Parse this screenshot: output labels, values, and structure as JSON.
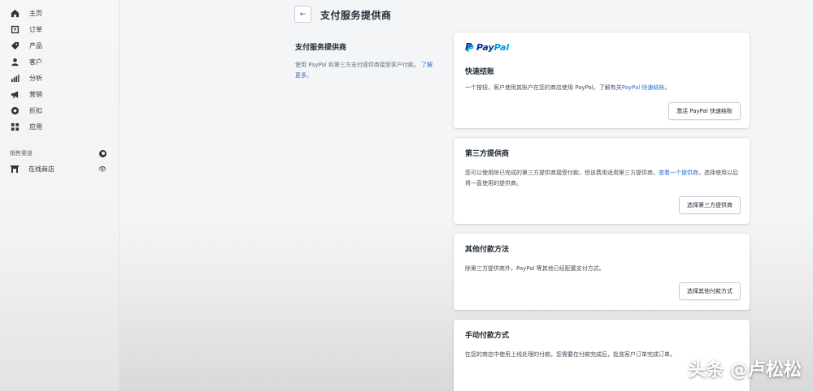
{
  "sidebar": {
    "items": [
      {
        "label": "主页",
        "icon": "home-icon"
      },
      {
        "label": "订单",
        "icon": "orders-icon"
      },
      {
        "label": "产品",
        "icon": "tag-icon"
      },
      {
        "label": "客户",
        "icon": "person-icon"
      },
      {
        "label": "分析",
        "icon": "bar-chart-icon"
      },
      {
        "label": "营销",
        "icon": "megaphone-icon"
      },
      {
        "label": "折扣",
        "icon": "discount-icon"
      },
      {
        "label": "应用",
        "icon": "apps-icon"
      }
    ],
    "section_label": "销售渠道",
    "channel": {
      "label": "在线商店",
      "icon": "store-icon"
    }
  },
  "header": {
    "back": "←",
    "title": "支付服务提供商"
  },
  "description": {
    "title": "支付服务提供商",
    "text": "使用 PayPal 和第三方支付提供商接受客户付款。",
    "link": "了解更多"
  },
  "cards": [
    {
      "logo_pay": "Pay",
      "logo_pal": "Pal",
      "title": "快速结账",
      "text": "一个按钮，客户使用其账户在您的商店使用 PayPal。了解有关",
      "link": "PayPal 快速结账",
      "text_end": "。",
      "button": "激活 PayPal 快速结账"
    },
    {
      "title": "第三方提供商",
      "text": "您可以使用除已完成的第三方提供商接受付款，但该费用适用第三方提供商。",
      "link": "查看一个提供商",
      "text_end": "，选择使用以后将一直使用的提供商。",
      "button": "选择第三方提供商"
    },
    {
      "title": "其他付款方法",
      "text": "除第三方提供商外，PayPal 等其他已经配置支付方式。",
      "button": "选择其他付款方式"
    },
    {
      "title": "手动付款方式",
      "text": "在您的商店中使用上线处理的付款。您需要在付款完成后，批准客户订单完成订单。"
    }
  ],
  "watermark": "头条 @卢松松"
}
